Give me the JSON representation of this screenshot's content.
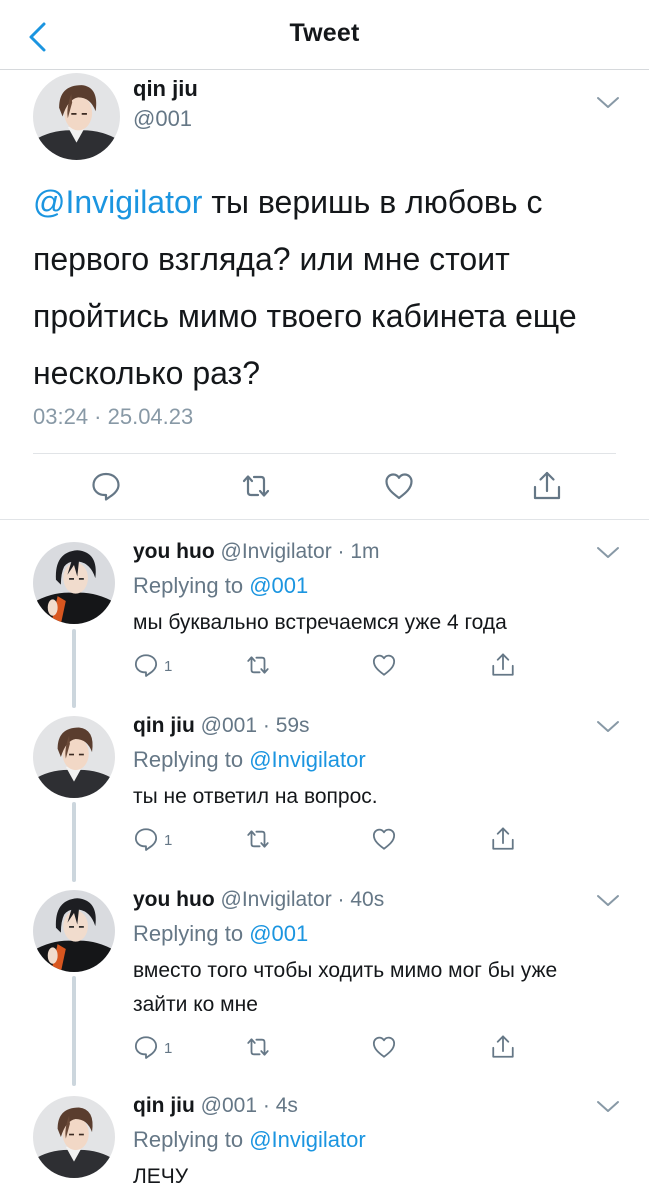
{
  "header": {
    "title": "Tweet",
    "back_icon": "chevron-left-icon"
  },
  "colors": {
    "accent": "#1b95e0",
    "secondary_text": "#657786",
    "divider": "#e1e4e7"
  },
  "main_tweet": {
    "name": "qin jiu",
    "handle": "@001",
    "mention": "@Invigilator",
    "text": " ты веришь в любовь с первого взгляда? или мне стоит пройтись мимо твоего кабинета еще несколько раз?",
    "timestamp": "03:24 · 25.04.23",
    "actions": [
      "reply-icon",
      "retweet-icon",
      "like-icon",
      "share-icon"
    ]
  },
  "replies": [
    {
      "name": "you huo",
      "meta": "@Invigilator · 1m",
      "replying_prefix": "Replying to ",
      "replying_to": "@001",
      "text": "мы буквально встречаемся уже 4 года",
      "reply_count": "1"
    },
    {
      "name": "qin jiu",
      "meta": "@001 · 59s",
      "replying_prefix": "Replying to ",
      "replying_to": "@Invigilator",
      "text": "ты не ответил на вопрос.",
      "reply_count": "1"
    },
    {
      "name": "you huo",
      "meta": "@Invigilator · 40s",
      "replying_prefix": "Replying to ",
      "replying_to": "@001",
      "text": "вместо того чтобы ходить мимо мог бы уже зайти ко мне",
      "reply_count": "1"
    },
    {
      "name": "qin jiu",
      "meta": "@001 · 4s",
      "replying_prefix": "Replying to ",
      "replying_to": "@Invigilator",
      "text": "ЛЕЧУ"
    }
  ]
}
